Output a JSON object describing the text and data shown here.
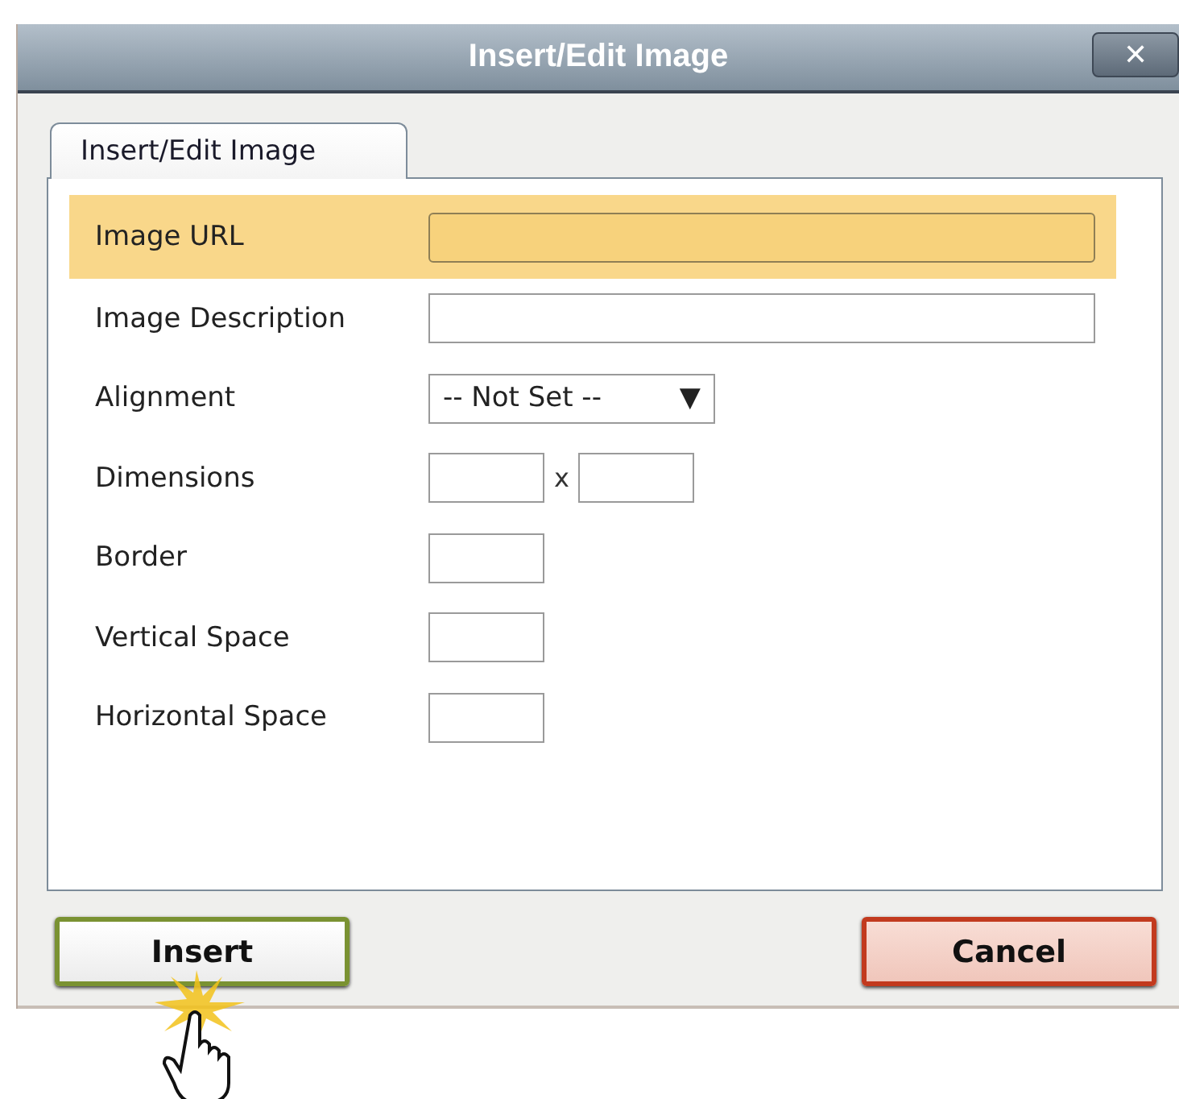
{
  "window": {
    "title": "Insert/Edit Image",
    "close": "✕"
  },
  "tabs": [
    {
      "label": "Insert/Edit Image",
      "selected": true
    }
  ],
  "fields": [
    {
      "label": "Image URL",
      "kind": "text",
      "focused": true
    },
    {
      "label": "Image Description",
      "kind": "text",
      "focused": false
    },
    {
      "label": "Alignment",
      "kind": "select",
      "value": "-- Not Set --",
      "arrow": "▼",
      "focused": false
    },
    {
      "label": "Dimensions",
      "kind": "pair",
      "separator": "x",
      "focused": false
    },
    {
      "label": "Border",
      "kind": "small",
      "focused": false
    },
    {
      "label": "Vertical Space",
      "kind": "small",
      "focused": false
    },
    {
      "label": "Horizontal Space",
      "kind": "small",
      "focused": false
    }
  ],
  "buttons": [
    {
      "label": "Insert",
      "kind": "confirm"
    },
    {
      "label": "Cancel",
      "kind": "cancel"
    }
  ]
}
